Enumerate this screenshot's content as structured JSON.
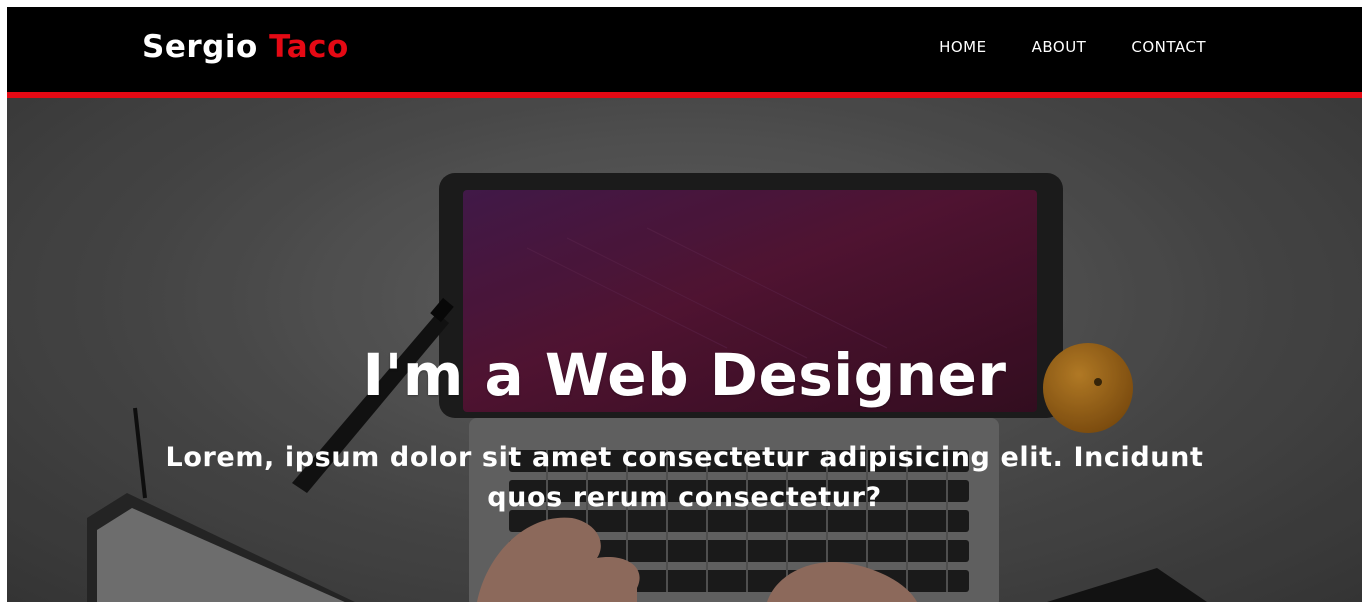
{
  "brand": {
    "first": "Sergio",
    "accent": "Taco",
    "accent_color": "#e50914"
  },
  "nav": {
    "items": [
      {
        "label": "HOME"
      },
      {
        "label": "ABOUT"
      },
      {
        "label": "CONTACT"
      }
    ]
  },
  "hero": {
    "title": "I'm a Web Designer",
    "subtitle": "Lorem, ipsum dolor sit amet consectetur adipisicing elit. Incidunt quos rerum consectetur?",
    "background_image": "laptop-workspace-photo"
  },
  "colors": {
    "header_bg": "#000000",
    "header_border": "#e50914",
    "text": "#ffffff"
  }
}
